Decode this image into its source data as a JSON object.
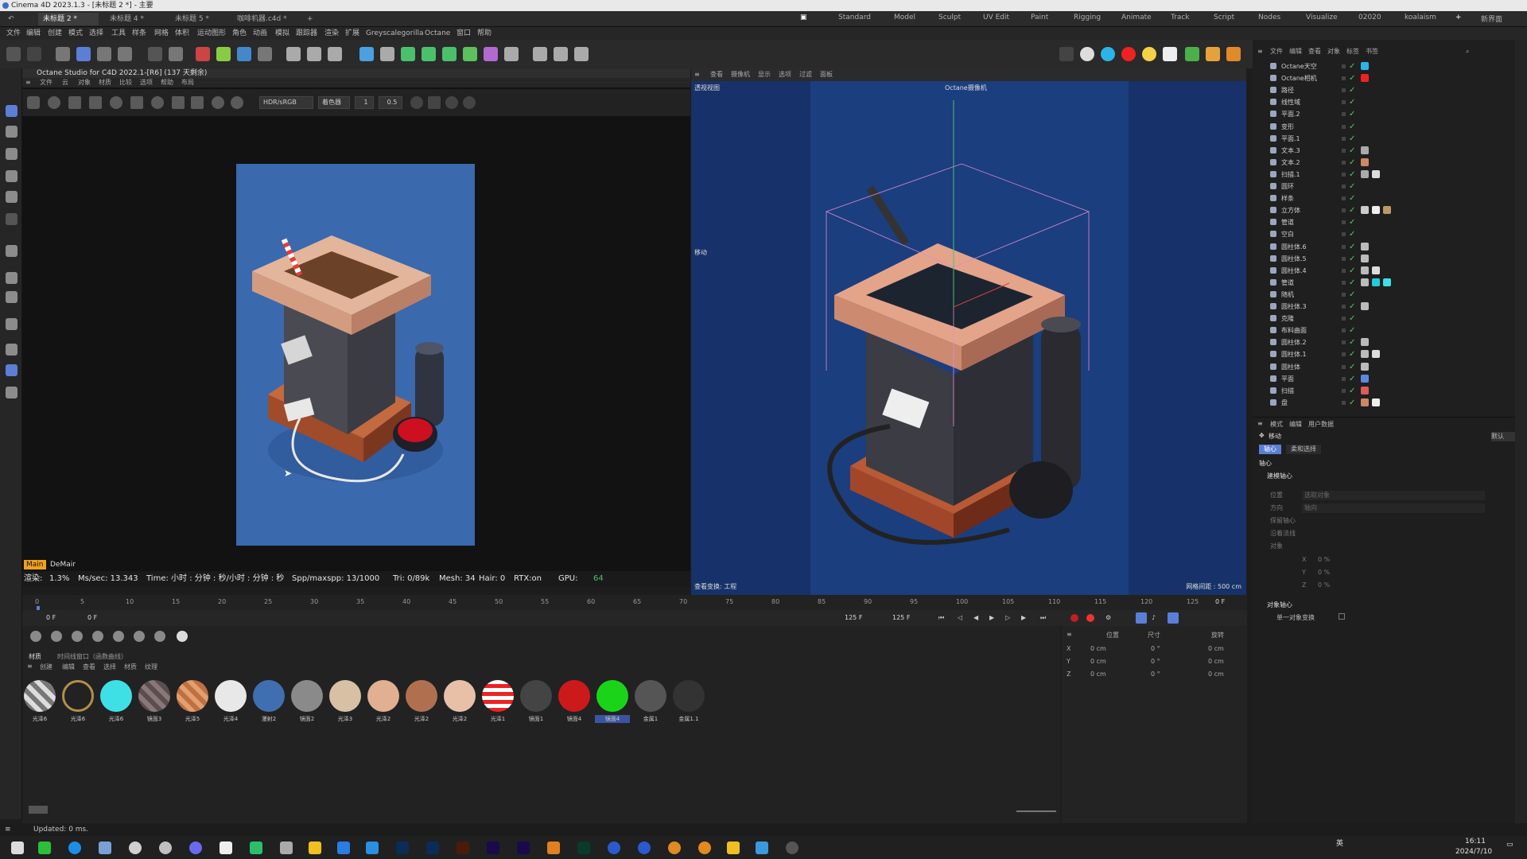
{
  "window": {
    "title": "Cinema 4D 2023.1.3 - [未标题 2 *] - 主要"
  },
  "doc_tabs": [
    "未标题 2 *",
    "未标题 4 *",
    "未标题 5 *",
    "咖啡机器.c4d *"
  ],
  "layouts": [
    "Standard",
    "Model",
    "Sculpt",
    "UV Edit",
    "Paint",
    "Rigging",
    "Animate",
    "Track",
    "Script",
    "Nodes",
    "Visualize",
    "02020",
    "koalaism",
    "新界面"
  ],
  "menu": [
    "文件",
    "编辑",
    "创建",
    "模式",
    "选择",
    "工具",
    "样条",
    "网格",
    "体积",
    "运动图形",
    "角色",
    "动画",
    "模拟",
    "跟踪器",
    "渲染",
    "扩展",
    "Greyscalegorilla",
    "Octane",
    "窗口",
    "帮助"
  ],
  "octane": {
    "title": "Octane Studio for C4D 2022.1-[R6] (137 天剩余)",
    "menu": [
      "文件",
      "云",
      "对象",
      "材质",
      "比较",
      "选项",
      "帮助",
      "布局"
    ],
    "mode": "HDR/sRGB",
    "channel": "着色器",
    "val1": "1",
    "val2": "0.5",
    "tab_main": "Main",
    "tab_demair": "DeMair"
  },
  "status": {
    "render": "渲染:",
    "pct": "1.3%",
    "ms": "Ms/sec: 13.343",
    "time": "Time: 小时 : 分钟 : 秒/小时 : 分钟 : 秒",
    "spp": "Spp/maxspp: 13/1000",
    "tri": "Tri: 0/89k",
    "mesh": "Mesh: 34",
    "hair": "Hair: 0",
    "rtx": "RTX:on",
    "gpu": "GPU:",
    "gpu_val": "64"
  },
  "viewport": {
    "label": "透视视图",
    "camera": "Octane摄像机",
    "move": "移动",
    "menu": [
      "查看",
      "摄像机",
      "显示",
      "选项",
      "过滤",
      "面板"
    ],
    "bottom_left": "查看变换: 工程",
    "grid": "网格间距 : 500 cm"
  },
  "timeline": {
    "ticks": [
      "0",
      "5",
      "10",
      "15",
      "20",
      "25",
      "30",
      "35",
      "40",
      "45",
      "50",
      "55",
      "60",
      "65",
      "70",
      "75",
      "80",
      "85",
      "90",
      "95",
      "100",
      "105",
      "110",
      "115",
      "120",
      "125"
    ],
    "start": "0 F",
    "current": "0 F",
    "end": "125 F",
    "end2": "125 F",
    "right": "0 F"
  },
  "materials": {
    "tabs": [
      "材质",
      "时间线窗口（函数曲线）"
    ],
    "menu": [
      "创建",
      "编辑",
      "查看",
      "选择",
      "材质",
      "纹理"
    ],
    "items": [
      "光泽6",
      "光泽6",
      "光泽6",
      "镜面3",
      "光泽5",
      "光泽4",
      "漫射2",
      "镜面2",
      "光泽3",
      "光泽2",
      "光泽2",
      "光泽2",
      "光泽1",
      "镜面1",
      "镜面4",
      "镜面4",
      "金属1",
      "金属1.1"
    ]
  },
  "coords": {
    "headers": [
      "位置",
      "尺寸",
      "旋转"
    ],
    "x": "X",
    "y": "Y",
    "z": "Z",
    "pos": "0 cm",
    "rot": "0 °"
  },
  "objects": {
    "menu": [
      "文件",
      "编辑",
      "查看",
      "对象",
      "标签",
      "书签"
    ],
    "rows": [
      "Octane天空",
      "Octane相机",
      "路径",
      "线性域",
      "平面.2",
      "变形",
      "平面.1",
      "文本.3",
      "文本.2",
      "扫描.1",
      "圆环",
      "样条",
      "立方体",
      "管道",
      "空白",
      "圆柱体.6",
      "圆柱体.5",
      "圆柱体.4",
      "管道",
      "随机",
      "圆柱体.3",
      "克隆",
      "布料曲面",
      "圆柱体.2",
      "圆柱体.1",
      "圆柱体",
      "平面",
      "扫描",
      "盘"
    ]
  },
  "attributes": {
    "menu": [
      "模式",
      "编辑",
      "用户数据"
    ],
    "title": "移动",
    "tab1": "轴心",
    "tab2": "柔和选择",
    "section": "轴心",
    "sub": "建模轴心",
    "fields": [
      "位置",
      "方向",
      "保留轴心",
      "沿着法线",
      "对象"
    ],
    "pos_val": "选取对象",
    "dir_val": "轴向",
    "xyz": [
      "X",
      "Y",
      "Z"
    ],
    "pct": "0 %",
    "section2": "对象轴心",
    "check": "单一对象变换",
    "default": "默认"
  },
  "footer": {
    "status": "Updated: 0 ms."
  },
  "tray": {
    "ime": "英",
    "time": "16:11",
    "date": "2024/7/10"
  }
}
